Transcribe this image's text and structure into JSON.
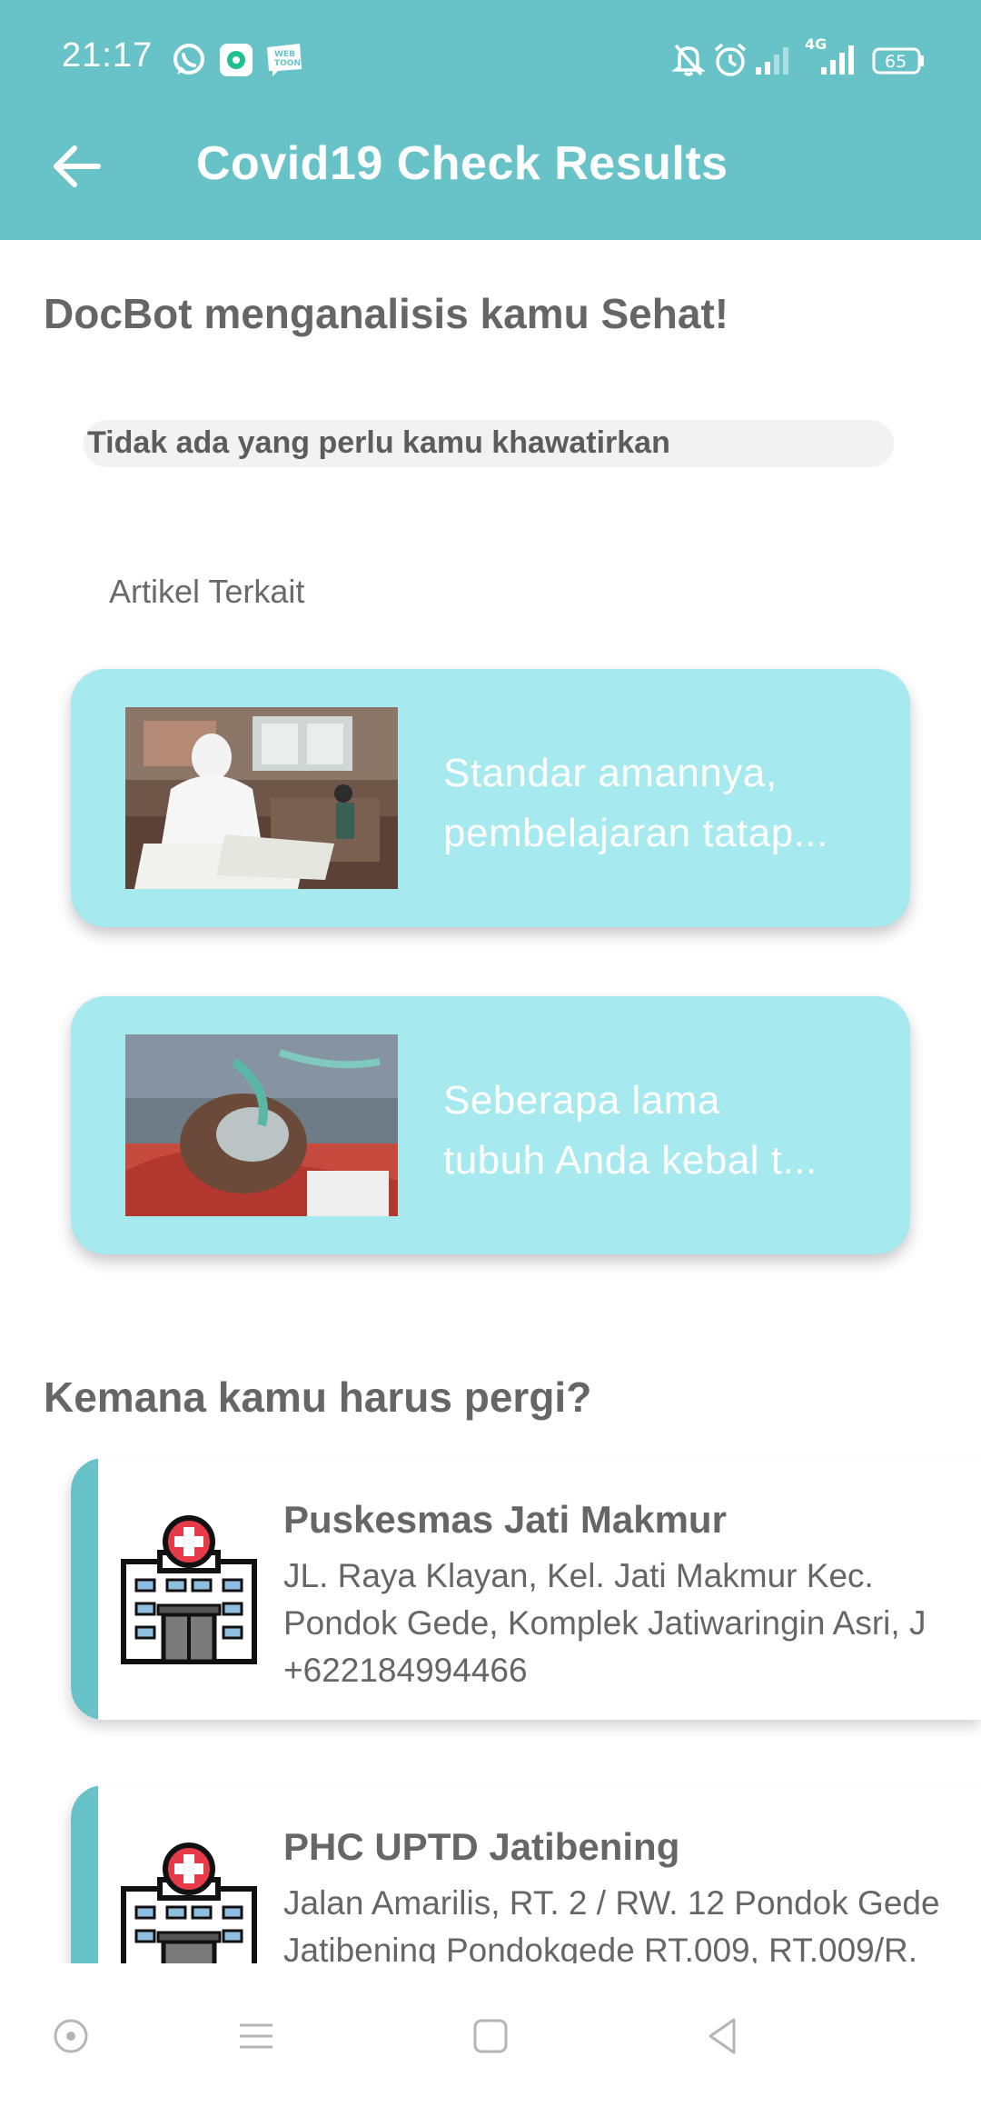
{
  "status_bar": {
    "time": "21:17",
    "network": "4G",
    "battery": "65",
    "notification_icons": [
      "whatsapp-icon",
      "chat-app-icon",
      "webtoon-icon"
    ],
    "right_icons": [
      "mute-icon",
      "alarm-icon",
      "signal-icon",
      "signal-4g-icon",
      "battery-icon"
    ]
  },
  "toolbar": {
    "title": "Covid19 Check Results",
    "back_icon": "arrow-left-icon"
  },
  "result": {
    "headline": "DocBot menganalisis kamu Sehat!",
    "note": "Tidak ada yang perlu kamu khawatirkan"
  },
  "articles": {
    "label": "Artikel Terkait",
    "items": [
      {
        "line1": "Standar amannya,",
        "line2": "pembelajaran tatap..."
      },
      {
        "line1": "Seberapa lama",
        "line2": "tubuh Anda kebal t..."
      }
    ]
  },
  "places": {
    "heading": "Kemana kamu harus pergi?",
    "items": [
      {
        "name": "Puskesmas Jati Makmur",
        "address_line1": "JL. Raya Klayan, Kel. Jati Makmur Kec.",
        "address_line2": "Pondok Gede, Komplek Jatiwaringin Asri, J",
        "phone": "+622184994466"
      },
      {
        "name": "PHC UPTD Jatibening",
        "address_line1": "Jalan Amarilis, RT. 2 / RW. 12 Pondok Gede",
        "address_line2": "Jatibening Pondokgede RT.009, RT.009/R."
      }
    ]
  },
  "colors": {
    "appbar": "#67c3c8",
    "article_card": "#a6e9ee",
    "text_gray": "#666666"
  }
}
